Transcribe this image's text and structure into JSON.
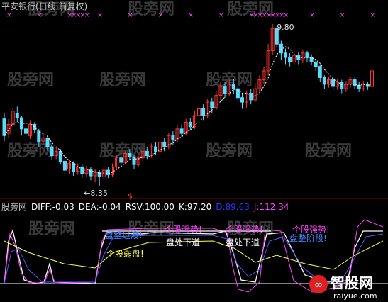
{
  "title": "平安银行(日线 前复权)",
  "watermarks": [
    "股旁网",
    "股旁网",
    "股旁网",
    "股旁网",
    "股旁网",
    "股旁网",
    "股旁网",
    "股旁网",
    "股旁网",
    "股旁网",
    "股旁网",
    "股旁网",
    "股旁网"
  ],
  "logo": {
    "text": "智股网",
    "sub": "raiyue.com"
  },
  "top_panel": {
    "high_label": "9.80",
    "low_label": "←8.35",
    "signal_mark": "$",
    "candles": [
      [
        0,
        8.95,
        8.8,
        9.0,
        8.75
      ],
      [
        1,
        8.82,
        8.9,
        8.95,
        8.78
      ],
      [
        2,
        8.9,
        9.02,
        9.05,
        8.88
      ],
      [
        3,
        9.0,
        8.96,
        9.06,
        8.92
      ],
      [
        4,
        8.96,
        8.86,
        8.98,
        8.8
      ],
      [
        5,
        8.86,
        8.82,
        8.9,
        8.76
      ],
      [
        6,
        8.8,
        8.9,
        8.94,
        8.77
      ],
      [
        7,
        8.9,
        8.85,
        8.92,
        8.82
      ],
      [
        8,
        8.84,
        8.74,
        8.86,
        8.7
      ],
      [
        9,
        8.75,
        8.78,
        8.82,
        8.72
      ],
      [
        10,
        8.78,
        8.7,
        8.8,
        8.66
      ],
      [
        11,
        8.7,
        8.62,
        8.72,
        8.58
      ],
      [
        12,
        8.62,
        8.66,
        8.7,
        8.59
      ],
      [
        13,
        8.66,
        8.57,
        8.68,
        8.54
      ],
      [
        14,
        8.57,
        8.49,
        8.6,
        8.44
      ],
      [
        15,
        8.5,
        8.55,
        8.58,
        8.46
      ],
      [
        16,
        8.55,
        8.48,
        8.57,
        8.44
      ],
      [
        17,
        8.48,
        8.52,
        8.55,
        8.45
      ],
      [
        18,
        8.52,
        8.46,
        8.54,
        8.42
      ],
      [
        19,
        8.46,
        8.5,
        8.53,
        8.43
      ],
      [
        20,
        8.5,
        8.44,
        8.52,
        8.4
      ],
      [
        21,
        8.44,
        8.47,
        8.5,
        8.38
      ],
      [
        22,
        8.47,
        8.43,
        8.49,
        8.35
      ],
      [
        23,
        8.43,
        8.49,
        8.51,
        8.4
      ],
      [
        24,
        8.49,
        8.45,
        8.52,
        8.42
      ],
      [
        25,
        8.45,
        8.52,
        8.55,
        8.43
      ],
      [
        26,
        8.52,
        8.6,
        8.63,
        8.5
      ],
      [
        27,
        8.6,
        8.56,
        8.64,
        8.53
      ],
      [
        28,
        8.56,
        8.64,
        8.66,
        8.54
      ],
      [
        29,
        8.64,
        8.61,
        8.68,
        8.58
      ],
      [
        30,
        8.61,
        8.54,
        8.63,
        8.5
      ],
      [
        31,
        8.54,
        8.6,
        8.62,
        8.52
      ],
      [
        32,
        8.6,
        8.66,
        8.69,
        8.57
      ],
      [
        33,
        8.66,
        8.62,
        8.7,
        8.59
      ],
      [
        34,
        8.62,
        8.7,
        8.73,
        8.6
      ],
      [
        35,
        8.7,
        8.66,
        8.74,
        8.63
      ],
      [
        36,
        8.66,
        8.74,
        8.77,
        8.64
      ],
      [
        37,
        8.74,
        8.7,
        8.78,
        8.66
      ],
      [
        38,
        8.7,
        8.8,
        8.82,
        8.68
      ],
      [
        39,
        8.8,
        8.76,
        8.84,
        8.72
      ],
      [
        40,
        8.76,
        8.86,
        8.89,
        8.74
      ],
      [
        41,
        8.86,
        8.82,
        8.9,
        8.79
      ],
      [
        42,
        8.82,
        8.92,
        8.95,
        8.8
      ],
      [
        43,
        8.92,
        8.88,
        8.96,
        8.85
      ],
      [
        44,
        8.88,
        8.98,
        9.02,
        8.86
      ],
      [
        45,
        8.98,
        9.04,
        9.08,
        8.95
      ],
      [
        46,
        9.04,
        8.98,
        9.08,
        8.94
      ],
      [
        47,
        8.98,
        9.1,
        9.13,
        8.96
      ],
      [
        48,
        9.1,
        9.05,
        9.14,
        9.0
      ],
      [
        49,
        9.05,
        9.16,
        9.2,
        9.03
      ],
      [
        50,
        9.16,
        9.24,
        9.28,
        9.12
      ],
      [
        51,
        9.24,
        9.18,
        9.28,
        9.14
      ],
      [
        52,
        9.18,
        9.26,
        9.3,
        9.15
      ],
      [
        53,
        9.26,
        9.22,
        9.31,
        9.17
      ],
      [
        54,
        9.22,
        9.14,
        9.24,
        9.1
      ],
      [
        55,
        9.14,
        9.1,
        9.18,
        9.04
      ],
      [
        56,
        9.1,
        9.18,
        9.2,
        9.05
      ],
      [
        57,
        9.18,
        9.12,
        9.22,
        9.08
      ],
      [
        58,
        9.12,
        9.22,
        9.26,
        9.1
      ],
      [
        59,
        9.22,
        9.3,
        9.34,
        9.18
      ],
      [
        60,
        9.3,
        9.38,
        9.42,
        9.26
      ],
      [
        61,
        9.38,
        9.56,
        9.62,
        9.34
      ],
      [
        62,
        9.56,
        9.76,
        9.8,
        9.52
      ],
      [
        63,
        9.76,
        9.62,
        9.78,
        9.58
      ],
      [
        64,
        9.62,
        9.54,
        9.65,
        9.48
      ],
      [
        65,
        9.54,
        9.5,
        9.58,
        9.44
      ],
      [
        66,
        9.5,
        9.46,
        9.54,
        9.42
      ],
      [
        67,
        9.46,
        9.52,
        9.56,
        9.43
      ],
      [
        68,
        9.52,
        9.48,
        9.55,
        9.44
      ],
      [
        69,
        9.48,
        9.54,
        9.57,
        9.45
      ],
      [
        70,
        9.54,
        9.5,
        9.56,
        9.46
      ],
      [
        71,
        9.5,
        9.46,
        9.53,
        9.43
      ],
      [
        72,
        9.46,
        9.42,
        9.49,
        9.38
      ],
      [
        73,
        9.42,
        9.32,
        9.44,
        9.28
      ],
      [
        74,
        9.32,
        9.26,
        9.34,
        9.22
      ],
      [
        75,
        9.26,
        9.3,
        9.33,
        9.23
      ],
      [
        76,
        9.3,
        9.24,
        9.32,
        9.2
      ],
      [
        77,
        9.24,
        9.28,
        9.31,
        9.21
      ],
      [
        78,
        9.28,
        9.22,
        9.3,
        9.18
      ],
      [
        79,
        9.22,
        9.26,
        9.29,
        9.19
      ],
      [
        80,
        9.26,
        9.3,
        9.33,
        9.23
      ],
      [
        81,
        9.3,
        9.25,
        9.32,
        9.22
      ],
      [
        82,
        9.25,
        9.22,
        9.28,
        9.19
      ],
      [
        83,
        9.22,
        9.26,
        9.29,
        9.2
      ],
      [
        84,
        9.26,
        9.24,
        9.28,
        9.21
      ],
      [
        85,
        9.24,
        9.38,
        9.42,
        9.22
      ]
    ]
  },
  "indicator": {
    "name": "股旁网",
    "fields": [
      {
        "label": "DIFF:",
        "value": "-0.03",
        "color": "#ffffff"
      },
      {
        "label": "DEA:",
        "value": "-0.04",
        "color": "#ffffff"
      },
      {
        "label": "RSV:",
        "value": "100.00",
        "color": "#ffffff"
      },
      {
        "label": "K:",
        "value": "97.20",
        "color": "#ffffff"
      },
      {
        "label": "D:",
        "value": "89.63",
        "color": "#3333ff"
      },
      {
        "label": "J:",
        "value": "112.34",
        "color": "#ff44ff"
      }
    ],
    "annotations": [
      {
        "text": "个股弱盘!",
        "color": "#ffff44"
      },
      {
        "text": "盘整过渡!",
        "color": "#4488ff"
      },
      {
        "text": "个股强势!",
        "color": "#ff44ff"
      },
      {
        "text": "盘处下道",
        "color": "#ffffff"
      },
      {
        "text": "个股强势!",
        "color": "#ff44ff"
      },
      {
        "text": "盘处下道",
        "color": "#ffffff"
      },
      {
        "text": "个股强势!",
        "color": "#ff44ff"
      },
      {
        "text": "盘整阶段!",
        "color": "#4488ff"
      }
    ]
  },
  "colors": {
    "up": "#ff3333",
    "down": "#55ddff",
    "text": "#c0c0c0",
    "bg": "#000000"
  }
}
